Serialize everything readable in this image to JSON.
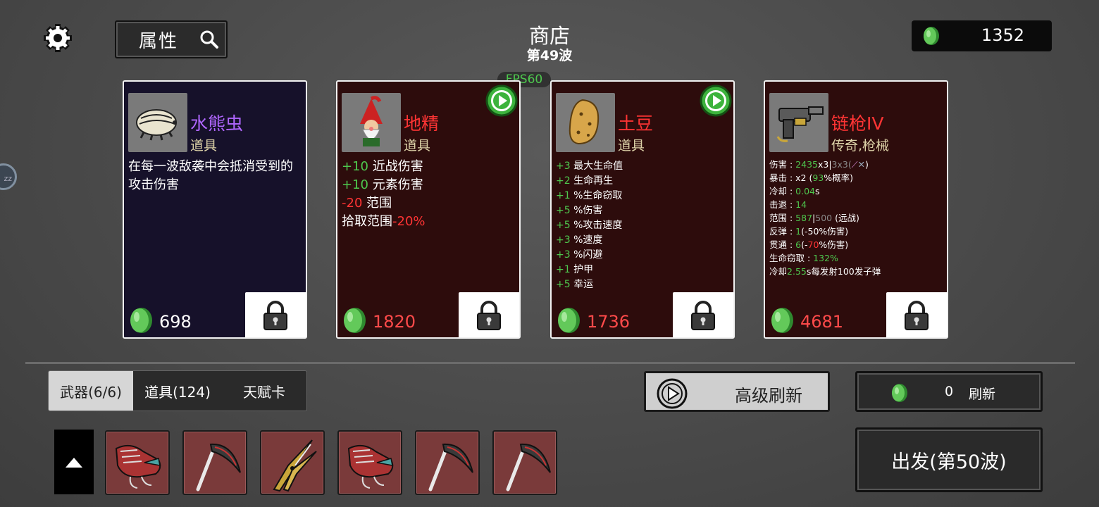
{
  "header": {
    "attributes_label": "属性",
    "title": "商店",
    "wave": "第49波",
    "fps": "FPS60",
    "gold": "1352"
  },
  "side_bubble": "zz",
  "cards": [
    {
      "name": "水熊虫",
      "name_color": "#b066ff",
      "type": "道具",
      "bg": "#16112a",
      "description": "在每一波敌袭中会抵消受到的攻击伤害",
      "price": "698",
      "price_color": "#ffffff",
      "has_play": false
    },
    {
      "name": "地精",
      "name_color": "#ff3434",
      "type": "道具",
      "bg": "#2d0c0c",
      "stats": [
        {
          "v": "+10",
          "t": "近战伤害"
        },
        {
          "v": "+10",
          "t": "元素伤害"
        },
        {
          "v": "-20",
          "t": "范围"
        },
        {
          "t": "拾取范围",
          "v2": "-20%"
        }
      ],
      "price": "1820",
      "price_color": "#ff4a4a",
      "has_play": true
    },
    {
      "name": "土豆",
      "name_color": "#ff3434",
      "type": "道具",
      "bg": "#2d0c0c",
      "stats": [
        {
          "v": "+3",
          "t": "最大生命值"
        },
        {
          "v": "+2",
          "t": "生命再生"
        },
        {
          "v": "+1",
          "t": "%生命窃取"
        },
        {
          "v": "+5",
          "t": "%伤害"
        },
        {
          "v": "+5",
          "t": "%攻击速度"
        },
        {
          "v": "+3",
          "t": "%速度"
        },
        {
          "v": "+3",
          "t": "%闪避"
        },
        {
          "v": "+1",
          "t": "护甲"
        },
        {
          "v": "+5",
          "t": "幸运"
        }
      ],
      "price": "1736",
      "price_color": "#ff4a4a",
      "has_play": true
    },
    {
      "name": "链枪IV",
      "name_color": "#ff3434",
      "type": "传奇,枪械",
      "bg": "#2d0c0c",
      "weapon_stats": {
        "damage_label": "伤害 : ",
        "damage_val": "2435",
        "damage_mult": "x3|",
        "damage_gray": "3x3(",
        "crit_label": "暴击 : x2 (",
        "crit_val": "93",
        "crit_suffix": "%概率)",
        "cooldown_label": "冷却 : ",
        "cooldown_val": "0.04",
        "cooldown_unit": "s",
        "knockback_label": "击退 : ",
        "knockback_val": "14",
        "range_label": "范围 : ",
        "range_val": "587",
        "range_sep": "|",
        "range_gray": "500",
        "range_suffix": " (远战)",
        "bounce_label": "反弹 : ",
        "bounce_val": "1",
        "bounce_suffix": "(-50%伤害)",
        "pierce_label": "贯通 : ",
        "pierce_val": "6",
        "pierce_open": "(-",
        "pierce_red": "70",
        "pierce_suffix": "%伤害)",
        "lifesteal_label": "生命窃取 : ",
        "lifesteal_val": "132%",
        "special_label": "冷却",
        "special_val": "2.55",
        "special_suffix": "s每发射100发子弹"
      },
      "price": "4681",
      "price_color": "#ff4a4a",
      "has_play": false
    }
  ],
  "tabs": [
    {
      "label": "武器(6/6)",
      "active": true
    },
    {
      "label": "道具(124)",
      "active": false
    },
    {
      "label": "天赋卡",
      "active": false
    }
  ],
  "buttons": {
    "advanced_refresh": "高级刷新",
    "refresh_cost": "0",
    "refresh": "刷新",
    "depart": "出发(第50波)"
  },
  "weapons": [
    "chain-gun-icon",
    "scythe-icon",
    "shears-icon",
    "chain-gun-icon",
    "scythe-icon",
    "scythe-icon"
  ],
  "colors": {
    "stat_positive": "#4ec84e",
    "stat_negative": "#ff3434",
    "weapon_slot": "#7a3a3a"
  }
}
